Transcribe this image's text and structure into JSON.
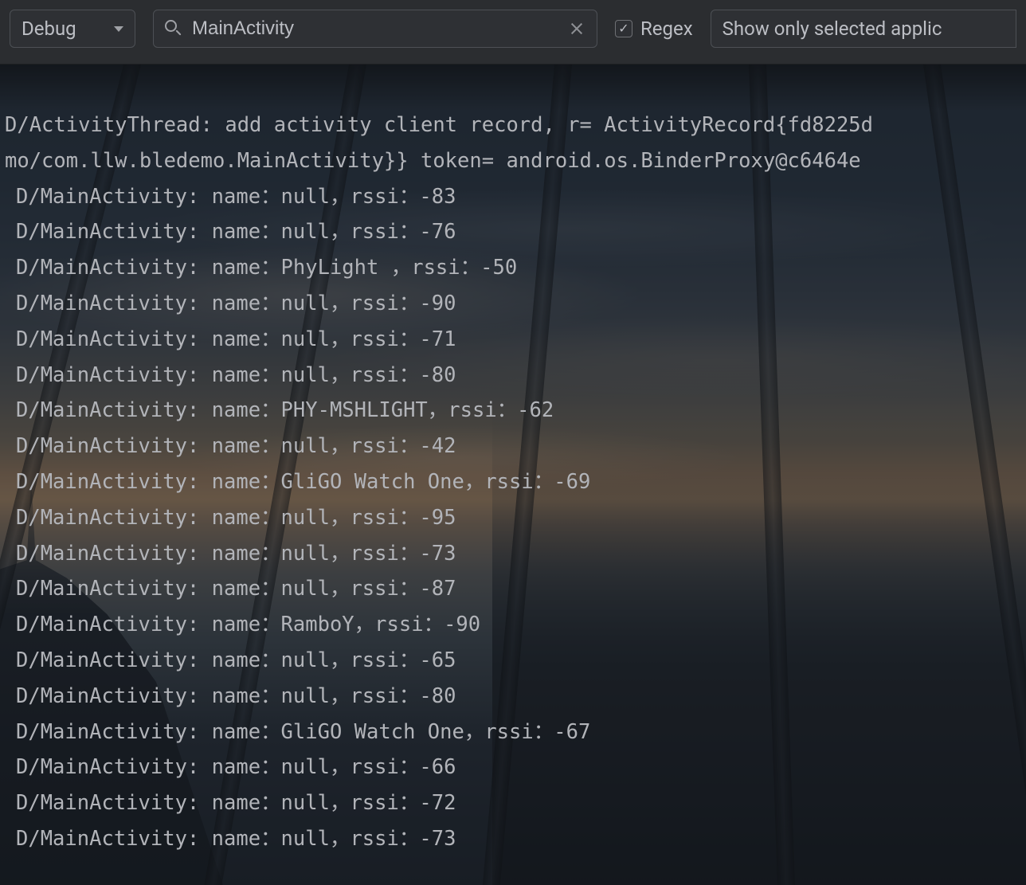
{
  "toolbar": {
    "log_level": "Debug",
    "filter_value": "MainActivity",
    "regex_label": "Regex",
    "regex_checked": true,
    "scope_label": "Show only selected applic"
  },
  "log": {
    "header": {
      "line1": "D/ActivityThread: add activity client record, r= ActivityRecord{fd8225d",
      "line2": "mo/com.llw.bledemo.MainActivity}} token= android.os.BinderProxy@c6464e"
    },
    "entries": [
      {
        "tag": "D/MainActivity",
        "name": "null",
        "rssi": -83
      },
      {
        "tag": "D/MainActivity",
        "name": "null",
        "rssi": -76
      },
      {
        "tag": "D/MainActivity",
        "name": "PhyLight ",
        "rssi": -50
      },
      {
        "tag": "D/MainActivity",
        "name": "null",
        "rssi": -90
      },
      {
        "tag": "D/MainActivity",
        "name": "null",
        "rssi": -71
      },
      {
        "tag": "D/MainActivity",
        "name": "null",
        "rssi": -80
      },
      {
        "tag": "D/MainActivity",
        "name": "PHY-MSHLIGHT",
        "rssi": -62
      },
      {
        "tag": "D/MainActivity",
        "name": "null",
        "rssi": -42
      },
      {
        "tag": "D/MainActivity",
        "name": "GliGO Watch One",
        "rssi": -69
      },
      {
        "tag": "D/MainActivity",
        "name": "null",
        "rssi": -95
      },
      {
        "tag": "D/MainActivity",
        "name": "null",
        "rssi": -73
      },
      {
        "tag": "D/MainActivity",
        "name": "null",
        "rssi": -87
      },
      {
        "tag": "D/MainActivity",
        "name": "RamboY",
        "rssi": -90
      },
      {
        "tag": "D/MainActivity",
        "name": "null",
        "rssi": -65
      },
      {
        "tag": "D/MainActivity",
        "name": "null",
        "rssi": -80
      },
      {
        "tag": "D/MainActivity",
        "name": "GliGO Watch One",
        "rssi": -67
      },
      {
        "tag": "D/MainActivity",
        "name": "null",
        "rssi": -66
      },
      {
        "tag": "D/MainActivity",
        "name": "null",
        "rssi": -72
      },
      {
        "tag": "D/MainActivity",
        "name": "null",
        "rssi": -73
      }
    ]
  }
}
